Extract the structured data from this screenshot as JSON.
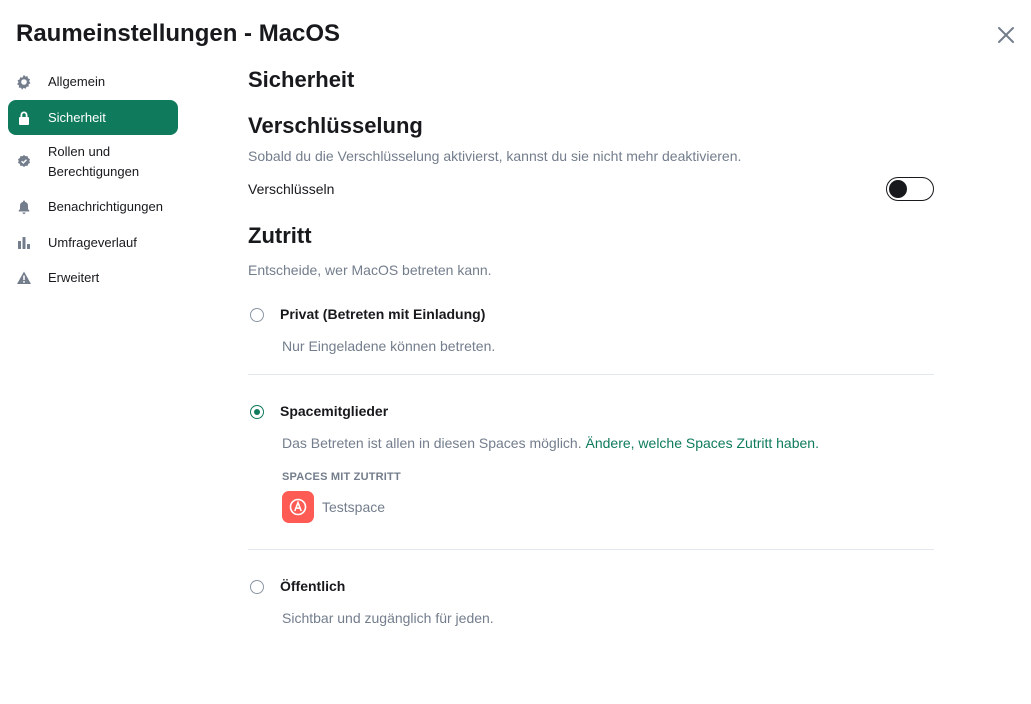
{
  "dialog": {
    "title": "Raumeinstellungen - MacOS",
    "close_icon": "close-icon"
  },
  "sidebar": {
    "items": [
      {
        "label": "Allgemein",
        "icon": "gear-icon"
      },
      {
        "label": "Sicherheit",
        "icon": "lock-icon",
        "active": true
      },
      {
        "label": "Rollen und Berechtigungen",
        "icon": "badge-icon"
      },
      {
        "label": "Benachrichtigungen",
        "icon": "bell-icon"
      },
      {
        "label": "Umfrageverlauf",
        "icon": "chart-icon"
      },
      {
        "label": "Erweitert",
        "icon": "warning-icon"
      }
    ]
  },
  "main": {
    "heading": "Sicherheit",
    "encryption": {
      "heading": "Verschlüsselung",
      "description": "Sobald du die Verschlüsselung aktivierst, kannst du sie nicht mehr deaktivieren.",
      "toggle_label": "Verschlüsseln",
      "enabled": false
    },
    "access": {
      "heading": "Zutritt",
      "description": "Entscheide, wer MacOS betreten kann.",
      "options": [
        {
          "title": "Privat (Betreten mit Einladung)",
          "description": "Nur Eingeladene können betreten.",
          "selected": false
        },
        {
          "title": "Spacemitglieder",
          "description": "Das Betreten ist allen in diesen Spaces möglich.",
          "link": "Ändere, welche Spaces Zutritt haben.",
          "selected": true
        },
        {
          "title": "Öffentlich",
          "description": "Sichtbar und zugänglich für jeden.",
          "selected": false
        }
      ],
      "spaces_label": "SPACES MIT ZUTRITT",
      "spaces": [
        {
          "name": "Testspace",
          "avatar_letter": "A"
        }
      ]
    }
  },
  "colors": {
    "accent": "#0f7b5c",
    "text": "#17191c",
    "muted": "#737d8c",
    "space_avatar": "#ff5b55"
  }
}
